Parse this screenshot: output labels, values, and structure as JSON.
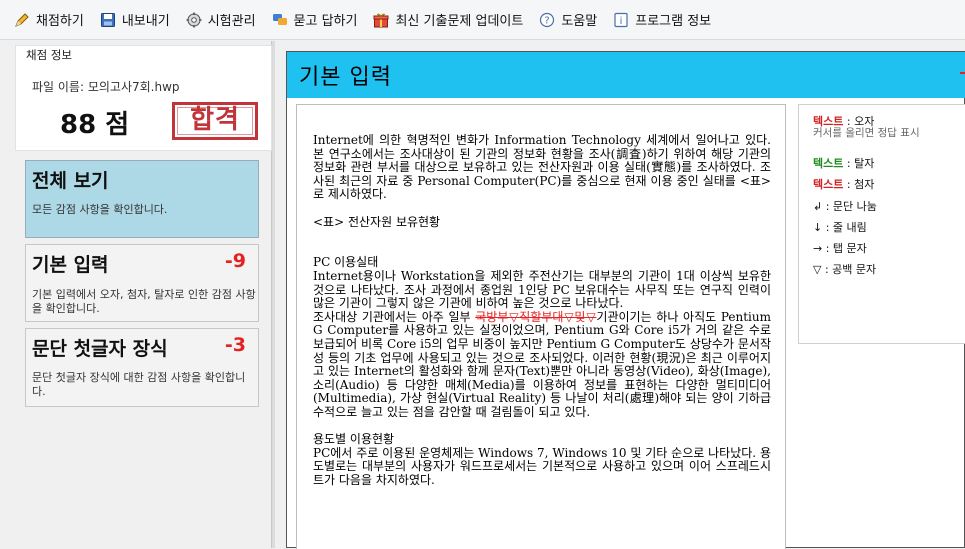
{
  "toolbar": {
    "items": [
      {
        "label": "채점하기",
        "icon": "pencil-icon"
      },
      {
        "label": "내보내기",
        "icon": "save-icon"
      },
      {
        "label": "시험관리",
        "icon": "gear-icon"
      },
      {
        "label": "묻고 답하기",
        "icon": "chat-icon"
      },
      {
        "label": "최신 기출문제 업데이트",
        "icon": "gift-icon"
      },
      {
        "label": "도움말",
        "icon": "help-icon"
      },
      {
        "label": "프로그램 정보",
        "icon": "info-icon"
      }
    ]
  },
  "score_panel": {
    "title": "채점 정보",
    "file_label": "파일 이름: 모의고사7회.hwp",
    "score": "88 점",
    "stamp": "합격"
  },
  "cards": [
    {
      "title": "전체 보기",
      "penalty": "",
      "desc": "모든 감점 사항을 확인합니다."
    },
    {
      "title": "기본 입력",
      "penalty": "-9",
      "desc": "기본 입력에서 오자, 첨자, 탈자로 인한 감점 사항을 확인합니다."
    },
    {
      "title": "문단 첫글자 장식",
      "penalty": "-3",
      "desc": "문단 첫글자 장식에 대한 감점 사항을 확인합니다."
    }
  ],
  "main": {
    "header_title": "기본 입력"
  },
  "document": {
    "p1": "Internet에 의한 혁명적인 변화가 Information Technology 세계에서 일어나고 있다. 본 연구소에서는 조사대상이 된 기관의 정보화 현황을 조사(調査)하기 위하여 해당 기관의 정보화 관련 부서를 대상으로 보유하고 있는 전산자원과 이용 실태(實態)를 조사하였다. 조사된 최근의 자료 중 Personal Computer(PC)를 중심으로 현재 이용 중인 실태를 <표>로 제시하였다.",
    "p2": "<표> 전산자원 보유현황",
    "p3": "PC 이용실태",
    "p4": "Internet용이나 Workstation을 제외한 주전산기는 대부분의 기관이 1대 이상씩 보유한 것으로 나타났다. 조사 과정에서 종업원 1인당 PC 보유대수는 사무직 또는 연구직 인력이 많은 기관이 그렇지 않은 기관에 비하여 높은 것으로 나타났다.",
    "p5_before": "조사대상 기관에서는 아주 일부 ",
    "p5_strike": "국방부▽직할부대▽및▽",
    "p5_after": "기관이기는 하나 아직도 Pentium G Computer를 사용하고 있는 실정이었으며, Pentium G와 Core i5가 거의 같은 수로 보급되어 비록 Core i5의 업무 비중이 높지만 Pentium G Computer도 상당수가 문서작성 등의 기초 업무에 사용되고 있는 것으로 조사되었다. 이러한 현황(現況)은 최근 이루어지고 있는 Internet의 활성화와 함께 문자(Text)뿐만 아니라 동영상(Video), 화상(Image), 소리(Audio) 등 다양한 매체(Media)를 이용하여 정보를 표현하는 다양한 멀티미디어(Multimedia), 가상 현실(Virtual Reality) 등 나날이 처리(處理)해야 되는 양이 기하급수적으로 늘고 있는 점을 감안할 때 걸림돌이 되고 있다.",
    "p6": "용도별 이용현황",
    "p7": "PC에서 주로 이용된 운영체제는 Windows 7, Windows 10 및 기타 순으로 나타났다. 용도별로는 대부분의 사용자가 워드프로세서는 기본적으로 사용하고 있으며 이어 스프레드시트가 다음을 차지하였다."
  },
  "legend": {
    "typo_word": "텍스트",
    "typo_label": ": 오자",
    "hover_hint": "커서를 올리면 정답 표시",
    "missing_word": "텍스트",
    "missing_label": ": 탈자",
    "extra_word": "텍스트",
    "extra_label": ": 첨자",
    "para_mark": "↲ : 문단 나눔",
    "line_mark": "↓ : 줄 내림",
    "tab_mark": "→ : 탭 문자",
    "space_mark": "▽ : 공백 문자"
  },
  "colors": {
    "header": "#1ec1f0",
    "active_card": "#add8e6",
    "penalty": "#e32222",
    "stamp": "#c0343a"
  }
}
